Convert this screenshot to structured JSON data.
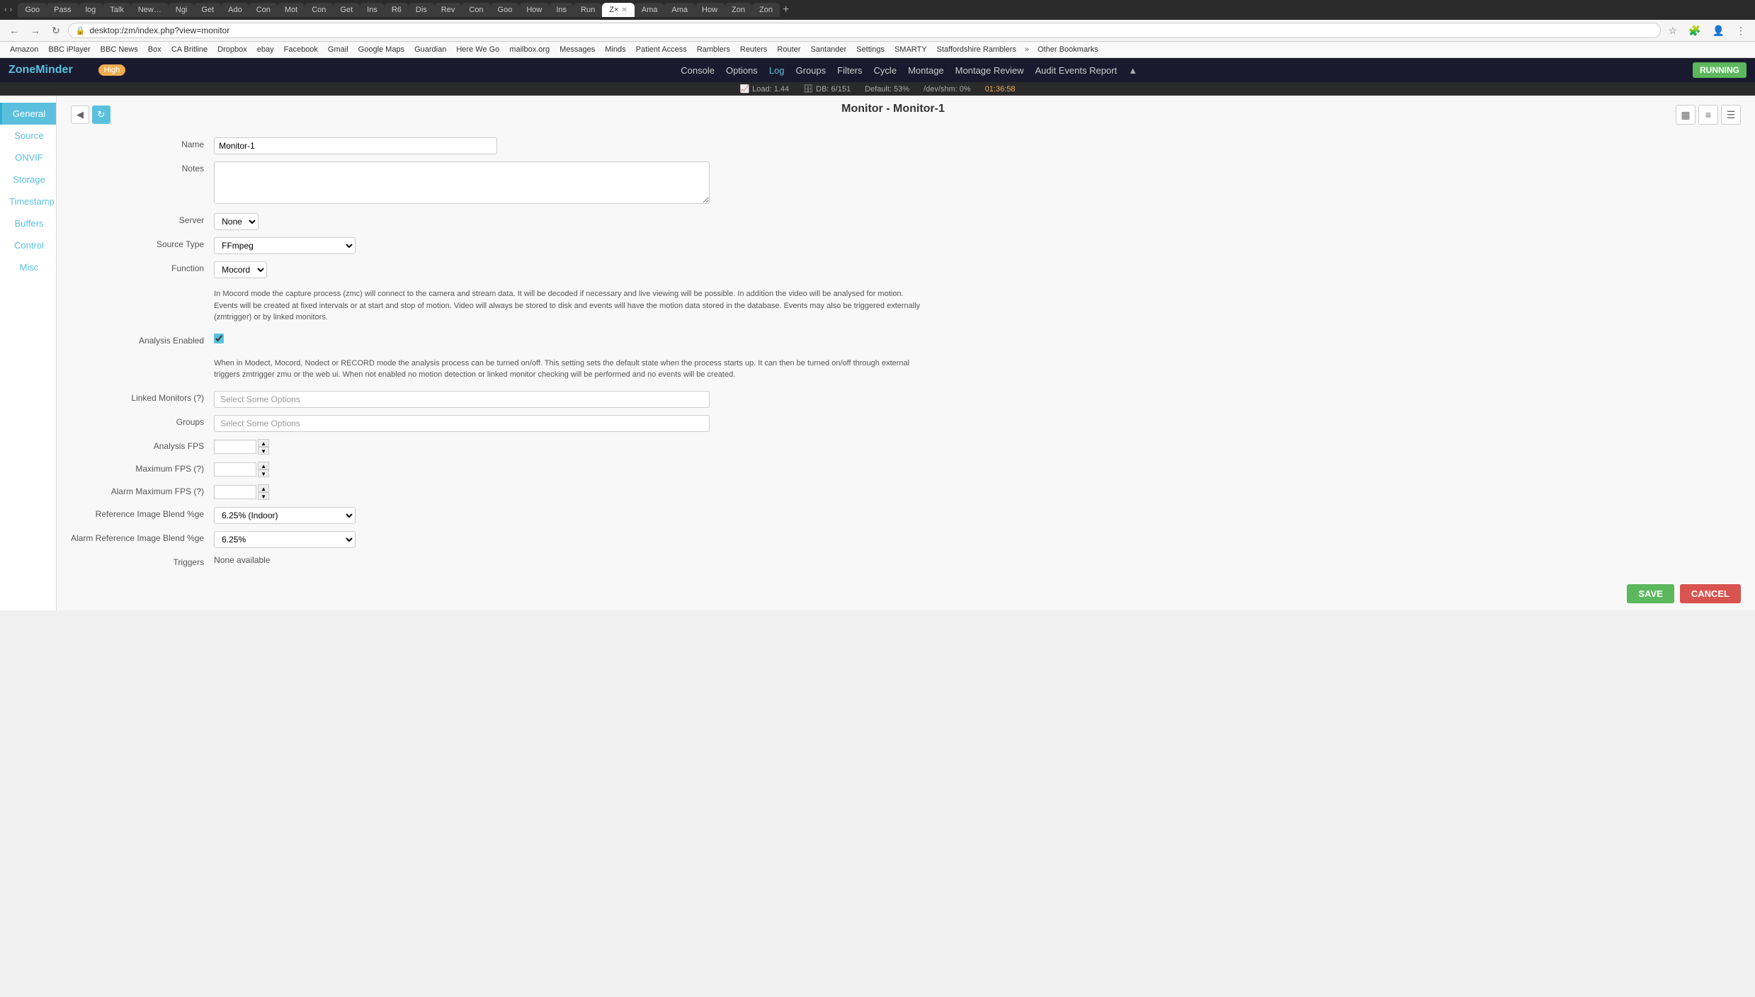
{
  "browser": {
    "url": "desktop:/zm/index.php?view=monitor",
    "tabs": [
      {
        "label": "Goo",
        "active": false
      },
      {
        "label": "Pass",
        "active": false
      },
      {
        "label": "log",
        "active": false
      },
      {
        "label": "Talk",
        "active": false
      },
      {
        "label": "New",
        "active": false
      },
      {
        "label": "Ngi",
        "active": false
      },
      {
        "label": "Get",
        "active": false
      },
      {
        "label": "Ado",
        "active": false
      },
      {
        "label": "Con",
        "active": false
      },
      {
        "label": "Mot",
        "active": false
      },
      {
        "label": "Con",
        "active": false
      },
      {
        "label": "Get",
        "active": false
      },
      {
        "label": "Ins",
        "active": false
      },
      {
        "label": "R6",
        "active": false
      },
      {
        "label": "Dis",
        "active": false
      },
      {
        "label": "Rev",
        "active": false
      },
      {
        "label": "Con",
        "active": false
      },
      {
        "label": "Goo",
        "active": false
      },
      {
        "label": "How",
        "active": false
      },
      {
        "label": "Ins",
        "active": false
      },
      {
        "label": "Run",
        "active": false
      },
      {
        "label": "Z×",
        "active": true
      },
      {
        "label": "Ama",
        "active": false
      },
      {
        "label": "Ama",
        "active": false
      },
      {
        "label": "How",
        "active": false
      },
      {
        "label": "Zon",
        "active": false
      },
      {
        "label": "Zon",
        "active": false
      }
    ],
    "bookmarks": [
      "Amazon",
      "BBC iPlayer",
      "BBC News",
      "Box",
      "CA Britline",
      "Dropbox",
      "ebay",
      "Facebook",
      "Gmail",
      "Google Maps",
      "Guardian",
      "Here We Go",
      "mailbox.org",
      "Messages",
      "Minds",
      "Patient Access",
      "Ramblers",
      "Reuters",
      "Router",
      "Santander",
      "Settings",
      "SMARTY",
      "Staffordshire Ramblers",
      "Other Bookmarks"
    ]
  },
  "app": {
    "logo": "ZoneMinder",
    "running_badge": "RUNNING",
    "high_badge": "High",
    "nav_links": [
      {
        "label": "Console",
        "active": false
      },
      {
        "label": "Options",
        "active": false
      },
      {
        "label": "Log",
        "active": true
      },
      {
        "label": "Groups",
        "active": false
      },
      {
        "label": "Filters",
        "active": false
      },
      {
        "label": "Cycle",
        "active": false
      },
      {
        "label": "Montage",
        "active": false
      },
      {
        "label": "Montage Review",
        "active": false
      },
      {
        "label": "Audit Events Report",
        "active": false
      }
    ],
    "status": {
      "load": "Load: 1.44",
      "db": "DB: 6/151",
      "default": "Default: 53%",
      "dev_shm": "/dev/shm: 0%",
      "time": "01:36:58"
    }
  },
  "sidebar": {
    "items": [
      {
        "label": "General",
        "active": true
      },
      {
        "label": "Source"
      },
      {
        "label": "ONVIF"
      },
      {
        "label": "Storage"
      },
      {
        "label": "Timestamp"
      },
      {
        "label": "Buffers"
      },
      {
        "label": "Control"
      },
      {
        "label": "Misc"
      }
    ]
  },
  "page": {
    "title": "Monitor - Monitor-1",
    "form": {
      "name_label": "Name",
      "name_value": "Monitor-1",
      "notes_label": "Notes",
      "notes_value": "",
      "server_label": "Server",
      "server_value": "None",
      "source_type_label": "Source Type",
      "source_type_value": "FFmpeg",
      "function_label": "Function",
      "function_value": "Mocord",
      "function_description": "In Mocord mode the capture process (zmc) will connect to the camera and stream data. It will be decoded if necessary and live viewing will be possible. In addition the video will be analysed for motion. Events will be created at fixed intervals or at start and stop of motion. Video will always be stored to disk and events will have the motion data stored in the database. Events may also be triggered externally (zmtrigger) or by linked monitors.",
      "analysis_enabled_label": "Analysis Enabled",
      "analysis_enabled_description": "When in Modect, Mocord, Nodect or RECORD mode the analysis process can be turned on/off. This setting sets the default state when the process starts up. It can then be turned on/off through external triggers zmtrigger zmu or the web ui. When not enabled no motion detection or linked monitor checking will be performed and no events will be created.",
      "linked_monitors_label": "Linked Monitors (?)",
      "linked_monitors_placeholder": "Select Some Options",
      "groups_label": "Groups",
      "groups_placeholder": "Select Some Options",
      "analysis_fps_label": "Analysis FPS",
      "analysis_fps_value": "",
      "maximum_fps_label": "Maximum FPS (?)",
      "maximum_fps_value": "",
      "alarm_maximum_fps_label": "Alarm Maximum FPS (?)",
      "alarm_maximum_fps_value": "",
      "ref_image_blend_label": "Reference Image Blend %ge",
      "ref_image_blend_value": "6.25% (Indoor)",
      "alarm_ref_image_blend_label": "Alarm Reference Image Blend %ge",
      "alarm_ref_image_blend_value": "6.25%",
      "triggers_label": "Triggers",
      "triggers_value": "None available",
      "save_button": "SAVE",
      "cancel_button": "CANCEL"
    }
  },
  "toolbar": {
    "back_icon": "◀",
    "refresh_icon": "↻",
    "icon1": "▦",
    "icon2": "≡",
    "icon3": "☰"
  }
}
